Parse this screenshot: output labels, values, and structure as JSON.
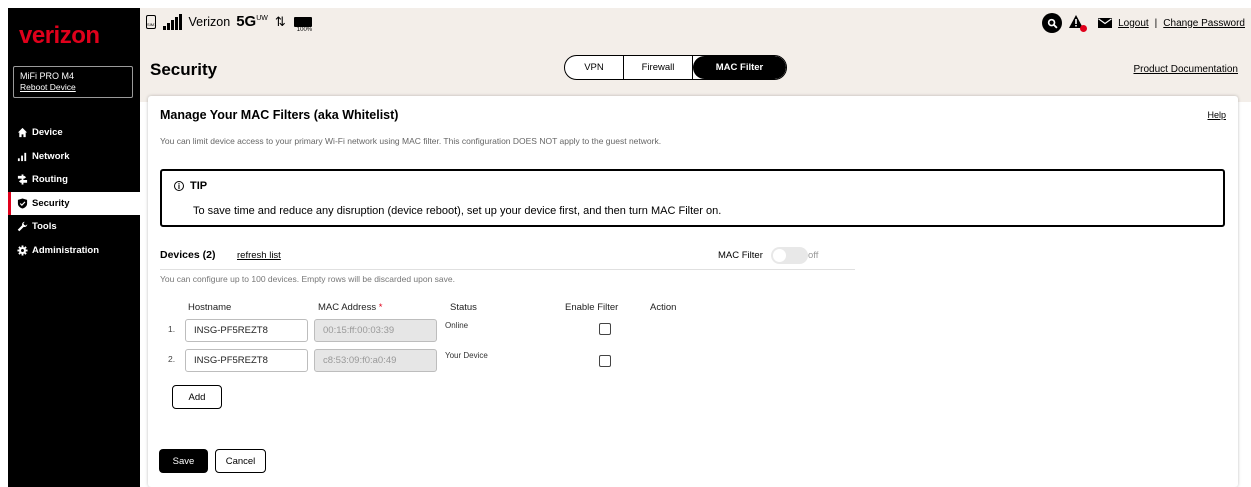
{
  "brand": {
    "logo": "verizon",
    "accent_color": "#e0001b"
  },
  "device_box": {
    "name": "MiFi PRO M4",
    "reboot_label": "Reboot Device"
  },
  "sidebar": {
    "items": [
      {
        "label": "Device",
        "icon": "home-icon"
      },
      {
        "label": "Network",
        "icon": "signal-icon"
      },
      {
        "label": "Routing",
        "icon": "routing-icon"
      },
      {
        "label": "Security",
        "icon": "shield-icon",
        "active": true
      },
      {
        "label": "Tools",
        "icon": "wrench-icon"
      },
      {
        "label": "Administration",
        "icon": "gear-icon"
      }
    ]
  },
  "statusbar": {
    "sim_label": "SIM1",
    "carrier": "Verizon",
    "network_type": "5G",
    "network_sup": "UW",
    "battery": "100%"
  },
  "header": {
    "logout": "Logout",
    "separator": "|",
    "change_password": "Change Password",
    "title": "Security",
    "tabs": [
      {
        "label": "VPN"
      },
      {
        "label": "Firewall"
      },
      {
        "label": "MAC Filter",
        "active": true
      }
    ],
    "product_doc": "Product Documentation"
  },
  "main": {
    "title": "Manage Your MAC Filters (aka Whitelist)",
    "help": "Help",
    "description": "You can limit device access to your primary Wi-Fi network using MAC filter. This configuration DOES NOT apply to the guest network.",
    "tip": {
      "heading": "TIP",
      "text": "To save time and reduce any disruption (device reboot), set up your device first, and then turn MAC Filter on."
    },
    "devices_title": "Devices (2)",
    "refresh": "refresh list",
    "mac_filter_label": "MAC Filter",
    "mac_filter_state": "off",
    "limit_text": "You can configure up to 100 devices. Empty rows will be discarded upon save.",
    "columns": {
      "hostname": "Hostname",
      "mac": "MAC Address",
      "mac_required": "*",
      "status": "Status",
      "enable": "Enable Filter",
      "action": "Action"
    },
    "rows": [
      {
        "num": "1.",
        "hostname": "INSG-PF5REZT8",
        "mac": "00:15:ff:00:03:39",
        "status": "Online",
        "enabled": false
      },
      {
        "num": "2.",
        "hostname": "INSG-PF5REZT8",
        "mac": "c8:53:09:f0:a0:49",
        "status": "Your Device",
        "enabled": false
      }
    ],
    "add_label": "Add",
    "save_label": "Save",
    "cancel_label": "Cancel"
  }
}
